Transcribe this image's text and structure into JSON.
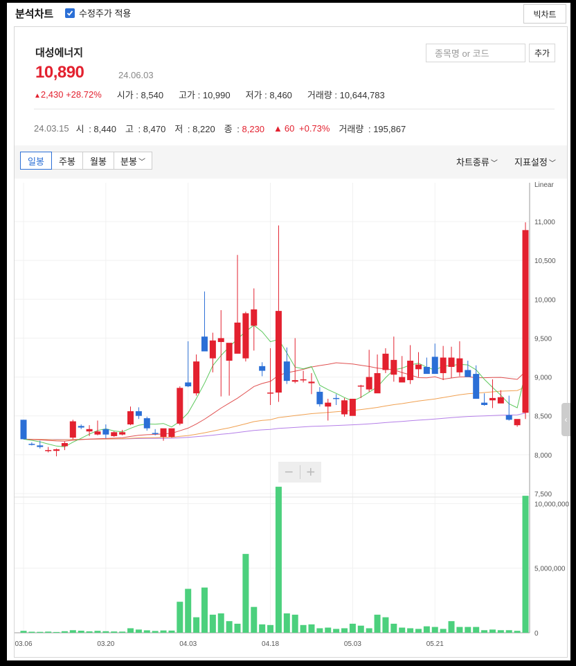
{
  "header": {
    "app_title": "분석차트",
    "adjusted_label": "수정주가 적용",
    "big_chart_label": "빅차트"
  },
  "stock": {
    "name": "대성에너지",
    "price": "10,890",
    "date": "24.06.03",
    "change": "2,430",
    "change_pct": "+28.72%",
    "open_label": "시가",
    "open": "8,540",
    "high_label": "고가",
    "high": "10,990",
    "low_label": "저가",
    "low": "8,460",
    "volume_label": "거래량",
    "volume": "10,644,783"
  },
  "search": {
    "placeholder": "종목명 or 코드",
    "add_label": "추가"
  },
  "hover": {
    "date": "24.03.15",
    "open_label": "시",
    "open": "8,440",
    "high_label": "고",
    "high": "8,470",
    "low_label": "저",
    "low": "8,220",
    "close_label": "종",
    "close": "8,230",
    "change": "60",
    "change_pct": "+0.73%",
    "volume_label": "거래량",
    "volume": "195,867"
  },
  "toolbar": {
    "periods": [
      "일봉",
      "주봉",
      "월봉",
      "분봉"
    ],
    "chart_type_label": "차트종류",
    "indicator_label": "지표설정"
  },
  "colors": {
    "up": "#e3212f",
    "down": "#2b6fd6",
    "volume": "#4cd07d",
    "ma5": "#5cc85c",
    "ma20": "#e05050",
    "ma60": "#f0a050",
    "ma120": "#b47ee8"
  },
  "chart_data": {
    "type": "candlestick",
    "scale_label": "Linear",
    "price_ticks": [
      "7,500",
      "8,000",
      "8,500",
      "9,000",
      "9,500",
      "10,000",
      "10,500",
      "11,000"
    ],
    "price_ylim": [
      7500,
      11000
    ],
    "volume_ticks": [
      "0",
      "5,000,000",
      "10,000,000"
    ],
    "volume_ylim": [
      0,
      12000000
    ],
    "x_labels": [
      "03.06",
      "03.20",
      "04.03",
      "04.18",
      "05.03",
      "05.21"
    ],
    "x_label_index": [
      0,
      10,
      20,
      30,
      40,
      50
    ],
    "candles": [
      [
        8450,
        8450,
        8200,
        8200,
        150000
      ],
      [
        8140,
        8160,
        8120,
        8130,
        80000
      ],
      [
        8120,
        8180,
        8080,
        8100,
        70000
      ],
      [
        8050,
        8100,
        8030,
        8060,
        90000
      ],
      [
        8050,
        8080,
        7980,
        8070,
        60000
      ],
      [
        8110,
        8170,
        8060,
        8150,
        120000
      ],
      [
        8220,
        8450,
        8200,
        8430,
        200000
      ],
      [
        8370,
        8390,
        8330,
        8350,
        160000
      ],
      [
        8300,
        8380,
        8240,
        8330,
        110000
      ],
      [
        8260,
        8440,
        8250,
        8300,
        150000
      ],
      [
        8330,
        8390,
        8210,
        8260,
        120000
      ],
      [
        8240,
        8300,
        8230,
        8290,
        100000
      ],
      [
        8260,
        8320,
        8250,
        8290,
        90000
      ],
      [
        8390,
        8620,
        8380,
        8560,
        350000
      ],
      [
        8560,
        8610,
        8460,
        8500,
        250000
      ],
      [
        8470,
        8490,
        8310,
        8340,
        190000
      ],
      [
        8280,
        8330,
        8250,
        8270,
        140000
      ],
      [
        8230,
        8330,
        8180,
        8340,
        180000
      ],
      [
        8230,
        8310,
        8220,
        8340,
        170000
      ],
      [
        8400,
        8880,
        8380,
        8860,
        2400000
      ],
      [
        8930,
        9460,
        8870,
        8880,
        3400000
      ],
      [
        8790,
        9290,
        8760,
        9200,
        1200000
      ],
      [
        9520,
        10100,
        9470,
        9330,
        3500000
      ],
      [
        9240,
        9570,
        9060,
        9470,
        1400000
      ],
      [
        9450,
        9860,
        8750,
        9500,
        1500000
      ],
      [
        9210,
        9310,
        8760,
        9440,
        900000
      ],
      [
        9300,
        10570,
        9310,
        9700,
        700000
      ],
      [
        9240,
        9840,
        9200,
        9820,
        6100000
      ],
      [
        9660,
        10140,
        9340,
        9870,
        2000000
      ],
      [
        9140,
        9190,
        9010,
        9080,
        650000
      ],
      [
        8790,
        9370,
        8640,
        8800,
        600000
      ],
      [
        8800,
        10950,
        8680,
        9850,
        11300000
      ],
      [
        9200,
        9380,
        8910,
        8950,
        1500000
      ],
      [
        8940,
        9500,
        8920,
        8960,
        1400000
      ],
      [
        8960,
        9080,
        8930,
        8970,
        600000
      ],
      [
        8920,
        9050,
        8780,
        8940,
        650000
      ],
      [
        8810,
        8870,
        8620,
        8650,
        350000
      ],
      [
        8620,
        8720,
        8440,
        8670,
        400000
      ],
      [
        8730,
        8780,
        8640,
        8720,
        300000
      ],
      [
        8520,
        8730,
        8490,
        8700,
        350000
      ],
      [
        8500,
        8670,
        8570,
        8720,
        700000
      ],
      [
        8880,
        8900,
        8730,
        8890,
        550000
      ],
      [
        8840,
        9350,
        8810,
        9000,
        350000
      ],
      [
        8790,
        9290,
        8800,
        9050,
        1400000
      ],
      [
        9090,
        9370,
        9050,
        9300,
        1200000
      ],
      [
        9030,
        9520,
        8940,
        9220,
        700000
      ],
      [
        8930,
        9270,
        8940,
        9000,
        400000
      ],
      [
        8960,
        9410,
        8910,
        9210,
        350000
      ],
      [
        9100,
        9320,
        9000,
        9160,
        300000
      ],
      [
        9130,
        9250,
        9080,
        9040,
        500000
      ],
      [
        9260,
        9430,
        9050,
        9040,
        450000
      ],
      [
        9050,
        9400,
        8960,
        9250,
        300000
      ],
      [
        9130,
        9390,
        8990,
        9250,
        900000
      ],
      [
        9060,
        9460,
        9010,
        9240,
        450000
      ],
      [
        9090,
        9210,
        9010,
        9000,
        450000
      ],
      [
        9040,
        9150,
        8740,
        8720,
        450000
      ],
      [
        8670,
        8790,
        8630,
        8640,
        200000
      ],
      [
        8700,
        8970,
        8600,
        8730,
        250000
      ],
      [
        8660,
        8830,
        8680,
        8740,
        200000
      ],
      [
        8510,
        8760,
        8440,
        8450,
        200000
      ],
      [
        8380,
        8430,
        8360,
        8460,
        150000
      ],
      [
        8540,
        10990,
        8460,
        10890,
        10600000
      ]
    ]
  }
}
